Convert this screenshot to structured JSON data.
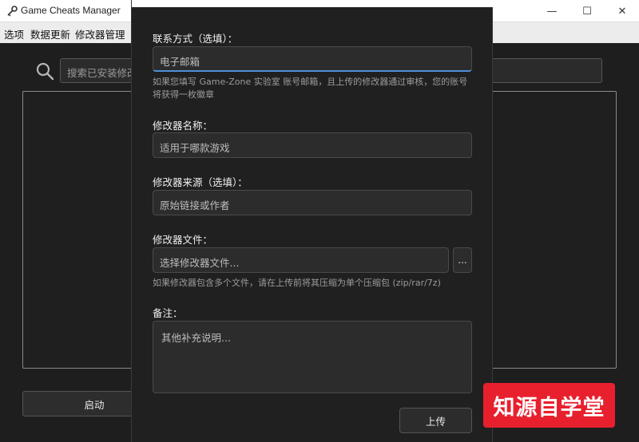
{
  "window": {
    "title": "Game Cheats Manager",
    "minimize_glyph": "—",
    "maximize_glyph": "☐",
    "close_glyph": "✕"
  },
  "menubar": {
    "items": [
      "选项",
      "数据更新",
      "修改器管理"
    ]
  },
  "main": {
    "search_placeholder": "搜索已安装修改器",
    "launch_label": "启动"
  },
  "dialog": {
    "contact": {
      "label": "联系方式（选填）：",
      "placeholder": "电子邮箱",
      "hint": "如果您填写 Game-Zone 实验室 账号邮箱，且上传的修改器通过审核，您的账号将获得一枚徽章"
    },
    "trainer_name": {
      "label": "修改器名称：",
      "placeholder": "适用于哪款游戏"
    },
    "source": {
      "label": "修改器来源（选填）：",
      "placeholder": "原始链接或作者"
    },
    "file": {
      "label": "修改器文件：",
      "placeholder": "选择修改器文件...",
      "browse_label": "...",
      "hint": "如果修改器包含多个文件，请在上传前将其压缩为单个压缩包 (zip/rar/7z)"
    },
    "notes": {
      "label": "备注：",
      "placeholder": "其他补充说明..."
    },
    "upload_label": "上传"
  },
  "watermark": {
    "text": "知源自学堂"
  },
  "colors": {
    "background": "#1e1e1e",
    "focus_accent": "#4c8fd6",
    "watermark": "#e8202e"
  },
  "icons": [
    "app-key-icon",
    "search-icon"
  ]
}
